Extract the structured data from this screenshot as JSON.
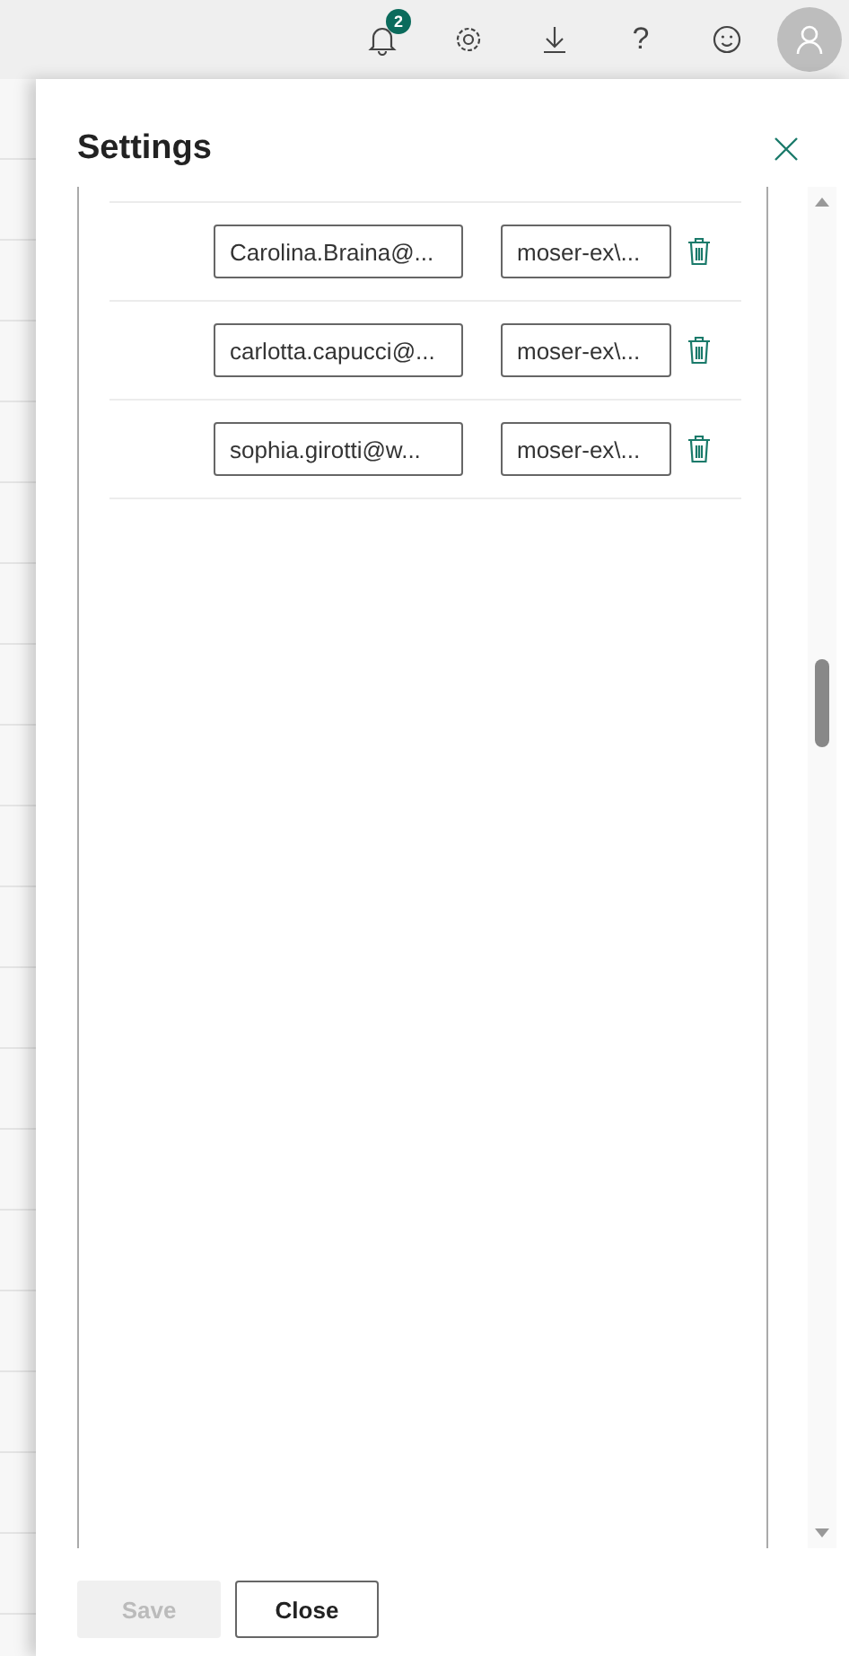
{
  "top_bar": {
    "notification_count": "2",
    "help": "?"
  },
  "panel": {
    "title": "Settings",
    "rows": [
      {
        "email": "Carolina.Braina@...",
        "account": "moser-ex\\..."
      },
      {
        "email": "carlotta.capucci@...",
        "account": "moser-ex\\..."
      },
      {
        "email": "sophia.girotti@w...",
        "account": "moser-ex\\..."
      }
    ],
    "buttons": [
      {
        "label": "Save",
        "disabled": true
      },
      {
        "label": "Close",
        "disabled": false
      }
    ]
  }
}
